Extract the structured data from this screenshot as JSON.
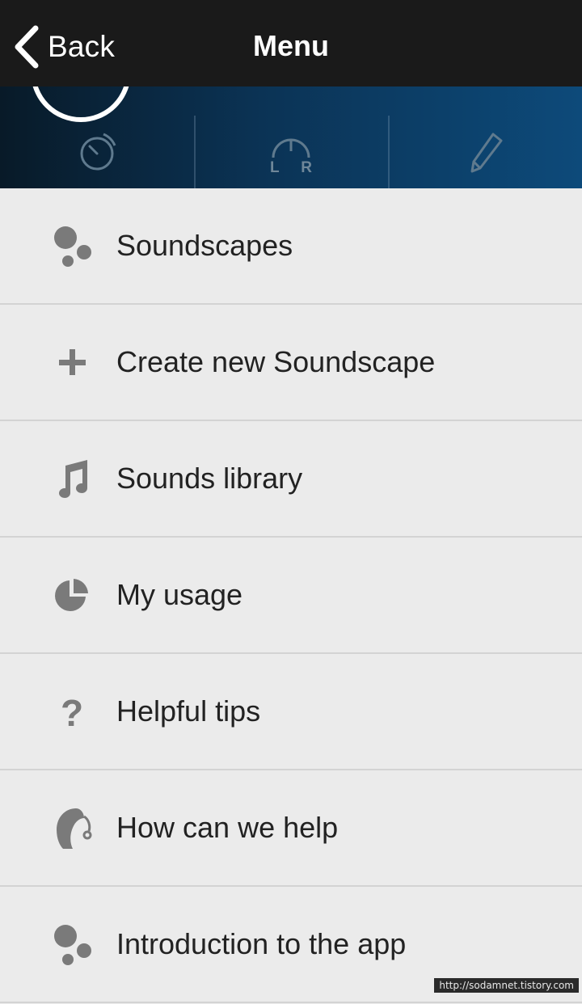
{
  "navbar": {
    "back_label": "Back",
    "title": "Menu"
  },
  "hero": {
    "controls": [
      {
        "icon": "timer-icon"
      },
      {
        "icon": "balance-lr-icon",
        "left": "L",
        "right": "R"
      },
      {
        "icon": "pencil-icon"
      }
    ]
  },
  "menu": {
    "items": [
      {
        "label": "Soundscapes",
        "icon": "soundscape-dots-icon"
      },
      {
        "label": "Create new Soundscape",
        "icon": "plus-icon"
      },
      {
        "label": "Sounds library",
        "icon": "music-note-icon"
      },
      {
        "label": "My usage",
        "icon": "pie-chart-icon"
      },
      {
        "label": "Helpful tips",
        "icon": "question-icon"
      },
      {
        "label": "How can we help",
        "icon": "hearing-aid-icon"
      },
      {
        "label": "Introduction to the app",
        "icon": "soundscape-dots-icon"
      }
    ]
  },
  "watermark": "http://sodamnet.tistory.com",
  "colors": {
    "navbar": "#1a1a1a",
    "hero_dark": "#081a28",
    "hero_light": "#0d4a7a",
    "list_bg": "#ebebeb",
    "icon_gray": "#7a7a7a"
  }
}
